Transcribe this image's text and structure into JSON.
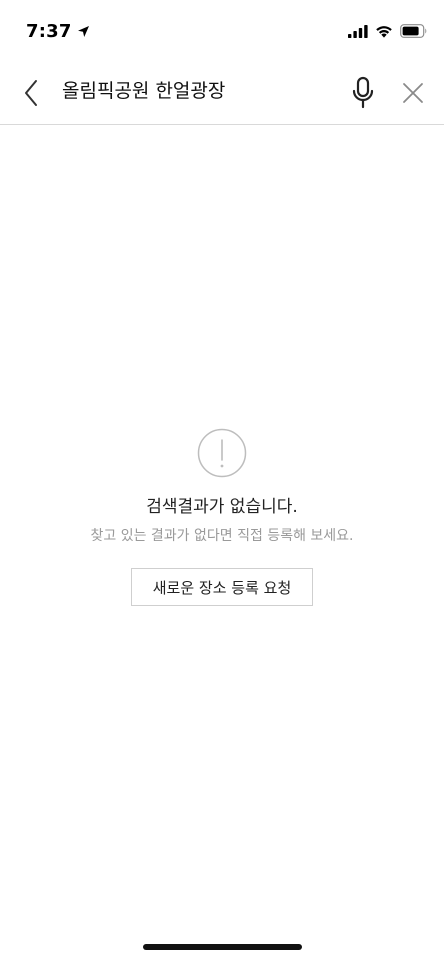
{
  "status_bar": {
    "time": "7:37",
    "icons": [
      "location-arrow-icon",
      "cellular-signal-icon",
      "wifi-icon",
      "battery-icon"
    ]
  },
  "search": {
    "query": "올림픽공원 한얼광장",
    "icons": {
      "back": "chevron-left-icon",
      "mic": "microphone-icon",
      "clear": "close-icon"
    }
  },
  "empty_state": {
    "icon": "alert-circle-icon",
    "title": "검색결과가 없습니다.",
    "description": "찾고 있는 결과가 없다면 직접 등록해 보세요.",
    "button_label": "새로운 장소 등록 요청"
  },
  "colors": {
    "text_primary": "#222222",
    "text_secondary": "#9a9a9a",
    "divider": "#d9d9d9",
    "icon_gray": "#8a8a8a"
  }
}
